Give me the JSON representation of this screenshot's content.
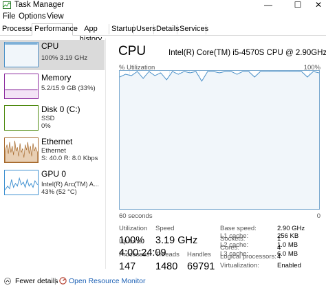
{
  "window": {
    "title": "Task Manager",
    "minimize_glyph": "—",
    "maximize_glyph": "☐",
    "close_glyph": "✕"
  },
  "menu": [
    "File",
    "Options",
    "View"
  ],
  "tabs": [
    "Processes",
    "Performance",
    "App history",
    "Startup",
    "Users",
    "Details",
    "Services"
  ],
  "active_tab": "Performance",
  "sidebar": {
    "items": [
      {
        "name": "CPU",
        "detail1": "100%  3.19 GHz",
        "selected": true
      },
      {
        "name": "Memory",
        "detail1": "5.2/15.9 GB (33%)"
      },
      {
        "name": "Disk 0 (C:)",
        "detail1": "SSD",
        "detail2": "0%"
      },
      {
        "name": "Ethernet",
        "detail1": "Ethernet",
        "detail2": "S: 40.0  R: 8.0 Kbps"
      },
      {
        "name": "GPU 0",
        "detail1": "Intel(R) Arc(TM) A...",
        "detail2": "43%  (52 °C)"
      }
    ]
  },
  "main": {
    "title": "CPU",
    "model": "Intel(R) Core(TM) i5-4570S CPU @ 2.90GHz",
    "graph_label": "% Utilization",
    "graph_max": "100%",
    "graph_time": "60 seconds",
    "graph_min": "0",
    "graph_utilization_percent": [
      96,
      98,
      97,
      100,
      95,
      100,
      97,
      99,
      94,
      100,
      98,
      100,
      99,
      100,
      93,
      100,
      100,
      99,
      100,
      100,
      98,
      100,
      100,
      96,
      100,
      100,
      100,
      100,
      100,
      100,
      100,
      100,
      96,
      100,
      99
    ],
    "stats": {
      "utilization_label": "Utilization",
      "utilization": "100%",
      "speed_label": "Speed",
      "speed": "3.19 GHz",
      "processes_label": "Processes",
      "processes": "147",
      "threads_label": "Threads",
      "threads": "1480",
      "handles_label": "Handles",
      "handles": "69791",
      "uptime_label": "Up time",
      "uptime": "4:00:24:09"
    },
    "specs": [
      {
        "label": "Base speed:",
        "value": "2.90 GHz"
      },
      {
        "label": "Sockets:",
        "value": "1"
      },
      {
        "label": "Cores:",
        "value": "4"
      },
      {
        "label": "Logical processors:",
        "value": "4"
      },
      {
        "label": "Virtualization:",
        "value": "Enabled"
      },
      {
        "label": "L1 cache:",
        "value": "256 KB"
      },
      {
        "label": "L2 cache:",
        "value": "1.0 MB"
      },
      {
        "label": "L3 cache:",
        "value": "6.0 MB"
      }
    ]
  },
  "footer": {
    "fewer_details": "Fewer details",
    "separator": "|",
    "open_monitor": "Open Resource Monitor"
  },
  "colors": {
    "cpu_line": "#4a90c8",
    "cpu_fill": "#f1f6fa",
    "memory": "#8b2a9e",
    "disk": "#4e8a0f",
    "ethernet": "#a5682a",
    "gpu": "#3b8ed0"
  }
}
